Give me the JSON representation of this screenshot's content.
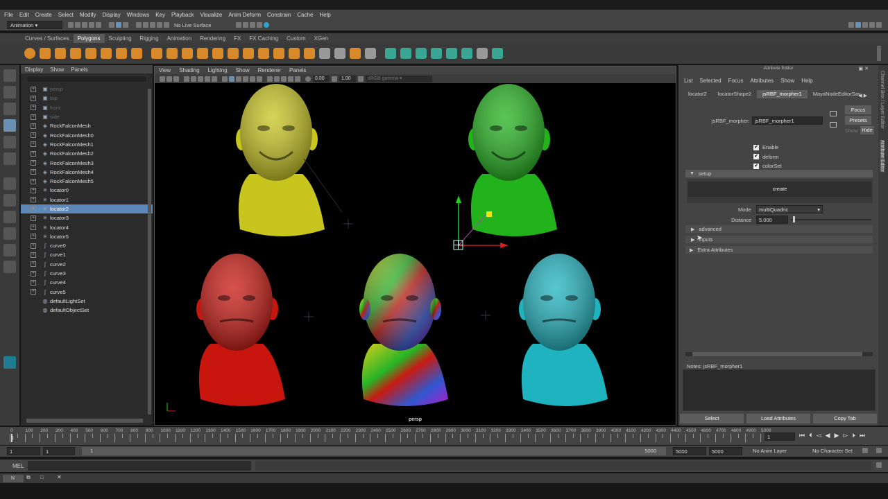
{
  "menubar": {
    "items": [
      "File",
      "Edit",
      "Create",
      "Select",
      "Modify",
      "Display",
      "Windows",
      "Key",
      "Playback",
      "Visualize",
      "Anim Deform",
      "Constrain",
      "Cache",
      "Help"
    ]
  },
  "statusline": {
    "menuset": "Animation",
    "live_surface": "No Live Surface"
  },
  "shelf": {
    "tabs": [
      "Curves / Surfaces",
      "Polygons",
      "Sculpting",
      "Rigging",
      "Animation",
      "Rendering",
      "FX",
      "FX Caching",
      "Custom",
      "XGen"
    ],
    "active_tab": "Polygons"
  },
  "outliner": {
    "menu": [
      "Display",
      "Show",
      "Panels"
    ],
    "items": [
      {
        "label": "persp",
        "icon": "camera-icon",
        "dim": true
      },
      {
        "label": "top",
        "icon": "camera-icon",
        "dim": true
      },
      {
        "label": "front",
        "icon": "camera-icon",
        "dim": true
      },
      {
        "label": "side",
        "icon": "camera-icon",
        "dim": true
      },
      {
        "label": "RockFalconMesh",
        "icon": "mesh-icon"
      },
      {
        "label": "RockFalconMesh0",
        "icon": "mesh-icon"
      },
      {
        "label": "RockFalconMesh1",
        "icon": "mesh-icon"
      },
      {
        "label": "RockFalconMesh2",
        "icon": "mesh-icon"
      },
      {
        "label": "RockFalconMesh3",
        "icon": "mesh-icon"
      },
      {
        "label": "RockFalconMesh4",
        "icon": "mesh-icon"
      },
      {
        "label": "RockFalconMesh5",
        "icon": "mesh-icon"
      },
      {
        "label": "locator0",
        "icon": "locator-icon"
      },
      {
        "label": "locator1",
        "icon": "locator-icon"
      },
      {
        "label": "locator2",
        "icon": "locator-icon",
        "selected": true
      },
      {
        "label": "locator3",
        "icon": "locator-icon"
      },
      {
        "label": "locator4",
        "icon": "locator-icon"
      },
      {
        "label": "locator5",
        "icon": "locator-icon"
      },
      {
        "label": "curve0",
        "icon": "curve-icon"
      },
      {
        "label": "curve1",
        "icon": "curve-icon"
      },
      {
        "label": "curve2",
        "icon": "curve-icon"
      },
      {
        "label": "curve3",
        "icon": "curve-icon"
      },
      {
        "label": "curve4",
        "icon": "curve-icon"
      },
      {
        "label": "curve5",
        "icon": "curve-icon"
      },
      {
        "label": "defaultLightSet",
        "icon": "set-icon",
        "nobox": true
      },
      {
        "label": "defaultObjectSet",
        "icon": "set-icon",
        "nobox": true
      }
    ]
  },
  "viewport": {
    "menu": [
      "View",
      "Shading",
      "Lighting",
      "Show",
      "Renderer",
      "Panels"
    ],
    "exposure": "0.00",
    "gamma": "1.00",
    "colorspace": "sRGB gamma",
    "camera": "persp",
    "heads": [
      {
        "name": "head-yellow",
        "color": "#c8c51e"
      },
      {
        "name": "head-green",
        "color": "#22b21c"
      },
      {
        "name": "head-red",
        "color": "#c8160f"
      },
      {
        "name": "head-rainbow",
        "color": "#88aa22"
      },
      {
        "name": "head-cyan",
        "color": "#1fb3bf"
      }
    ]
  },
  "attribute_editor": {
    "title": "Attribute Editor",
    "menu": [
      "List",
      "Selected",
      "Focus",
      "Attributes",
      "Show",
      "Help"
    ],
    "tabs": [
      "locator2",
      "locatorShape2",
      "jsRBF_morpher1",
      "MayaNodeEditorSav"
    ],
    "active_tab": "jsRBF_morpher1",
    "node_label": "jsRBF_morpher:",
    "node_value": "jsRBF_morpher1",
    "side_buttons": [
      "Focus",
      "Presets"
    ],
    "show_label": "Show",
    "hide_label": "Hide",
    "checks": [
      {
        "label": "Enable",
        "checked": true
      },
      {
        "label": "deform",
        "checked": true
      },
      {
        "label": "colorSet",
        "checked": true
      }
    ],
    "setup_section": "setup",
    "create_button": "create",
    "mode_label": "Mode",
    "mode_value": "multiQuadric",
    "distance_label": "Distance",
    "distance_value": "5.000",
    "distance_fraction": 0.03,
    "collapsed_sections": [
      "advanced",
      "inputs",
      "Extra Attributes"
    ],
    "notes_label": "Notes: jsRBF_morpher1",
    "bottom_buttons": [
      "Select",
      "Load Attributes",
      "Copy Tab"
    ],
    "side_tabs": [
      "Channel Box / Layer Editor",
      "Attribute Editor"
    ]
  },
  "timeslider": {
    "ticks": [
      "0",
      "50",
      "100",
      "150",
      "200",
      "250",
      "300",
      "350",
      "400",
      "450",
      "500",
      "550",
      "600",
      "650",
      "700",
      "750",
      "800",
      "850",
      "900",
      "950",
      "1000",
      "1050",
      "1100",
      "1150",
      "1200",
      "1250",
      "1300",
      "1350",
      "1400",
      "1450",
      "1500",
      "1550",
      "1600",
      "1650",
      "1700",
      "1750",
      "1800",
      "1850",
      "1900",
      "1950",
      "2000",
      "2050",
      "2100",
      "2150",
      "2200",
      "2250",
      "2300",
      "2350",
      "2400",
      "2450",
      "2500",
      "2550",
      "2600",
      "2650",
      "2700",
      "2750",
      "2800",
      "2850",
      "2900",
      "2950",
      "3000",
      "3050",
      "3100",
      "3150",
      "3200",
      "3250",
      "3300",
      "3350",
      "3400",
      "3450",
      "3500",
      "3550",
      "3600",
      "3650",
      "3700",
      "3750",
      "3800",
      "3850",
      "3900",
      "3950",
      "4000",
      "4050",
      "4100",
      "4150",
      "4200",
      "4250",
      "4300",
      "4350",
      "4400",
      "4450",
      "4500",
      "4550",
      "4600",
      "4650",
      "4700",
      "4750",
      "4800",
      "4850",
      "4900",
      "4950",
      "5000"
    ],
    "current_frame": "1",
    "frame_field": "1"
  },
  "rangebar": {
    "start": "1",
    "anim_start": "1",
    "range_start_label": "1",
    "range_end_label": "5000",
    "anim_end": "5000",
    "end": "5000",
    "anim_layer": "No Anim Layer",
    "char_set": "No Character Set"
  },
  "cmdline": {
    "label": "MEL"
  },
  "helpline": {
    "label": "N"
  }
}
